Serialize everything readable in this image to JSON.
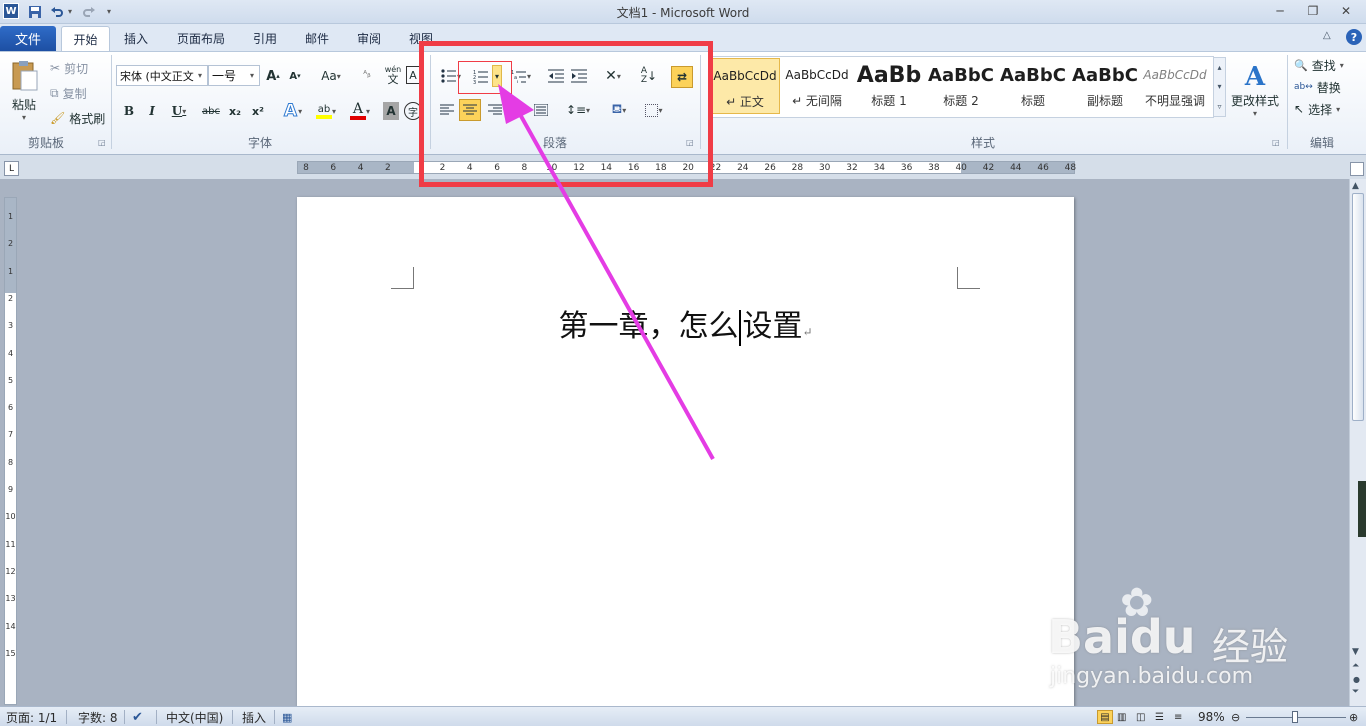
{
  "window": {
    "title": "文档1 - Microsoft Word"
  },
  "tabs": [
    {
      "label": "文件",
      "active": false
    },
    {
      "label": "开始",
      "active": true
    },
    {
      "label": "插入",
      "active": false
    },
    {
      "label": "页面布局",
      "active": false
    },
    {
      "label": "引用",
      "active": false
    },
    {
      "label": "邮件",
      "active": false
    },
    {
      "label": "审阅",
      "active": false
    },
    {
      "label": "视图",
      "active": false
    }
  ],
  "clipboard": {
    "paste": "粘贴",
    "cut": "剪切",
    "copy": "复制",
    "format_painter": "格式刷",
    "label": "剪贴板"
  },
  "font": {
    "name": "宋体 (中文正文",
    "size": "一号",
    "label": "字体",
    "grow": "A",
    "shrink": "A",
    "case": "Aa",
    "bold": "B",
    "italic": "I",
    "underline": "U",
    "strike": "abc",
    "sub": "x₂",
    "sup": "x²",
    "color_letter": "A",
    "wen": "wén",
    "wen2": "文",
    "zi": "字"
  },
  "paragraph": {
    "label": "段落"
  },
  "styles": {
    "label": "样式",
    "items": [
      {
        "sample": "AaBbCcDd",
        "name": "↵ 正文"
      },
      {
        "sample": "AaBbCcDd",
        "name": "↵ 无间隔"
      },
      {
        "sample": "AaBb",
        "name": "标题 1"
      },
      {
        "sample": "AaBbC",
        "name": "标题 2"
      },
      {
        "sample": "AaBbC",
        "name": "标题"
      },
      {
        "sample": "AaBbC",
        "name": "副标题"
      },
      {
        "sample": "AaBbCcDd",
        "name": "不明显强调"
      }
    ],
    "change_styles": "更改样式"
  },
  "editing": {
    "find": "查找",
    "replace": "替换",
    "select": "选择",
    "label": "编辑"
  },
  "ruler": {
    "labels": [
      "8",
      "6",
      "4",
      "2",
      "",
      "2",
      "4",
      "6",
      "8",
      "10",
      "12",
      "14",
      "16",
      "18",
      "20",
      "22",
      "24",
      "26",
      "28",
      "30",
      "32",
      "34",
      "36",
      "38",
      "40",
      "42",
      "44",
      "46",
      "48"
    ]
  },
  "vruler": {
    "labels": [
      "1",
      "2",
      "1",
      "2",
      "3",
      "4",
      "5",
      "6",
      "7",
      "8",
      "9",
      "10",
      "11",
      "12",
      "13",
      "14",
      "15"
    ]
  },
  "document": {
    "text_before": "第一章，怎么",
    "text_after": "设置",
    "pilcrow": "↵"
  },
  "status": {
    "page": "页面: 1/1",
    "words": "字数: 8",
    "lang": "中文(中国)",
    "mode": "插入",
    "zoom": "98%"
  },
  "watermark": {
    "brand": "Bai",
    "brand2": "du",
    "site": "经验",
    "url": "jingyan.baidu.com"
  },
  "colors": {
    "accent": "#2b5797",
    "highlight_box": "#f03c46",
    "arrow": "#e43ce4",
    "font_color": "#e00000",
    "text_highlight": "#ffff00"
  }
}
